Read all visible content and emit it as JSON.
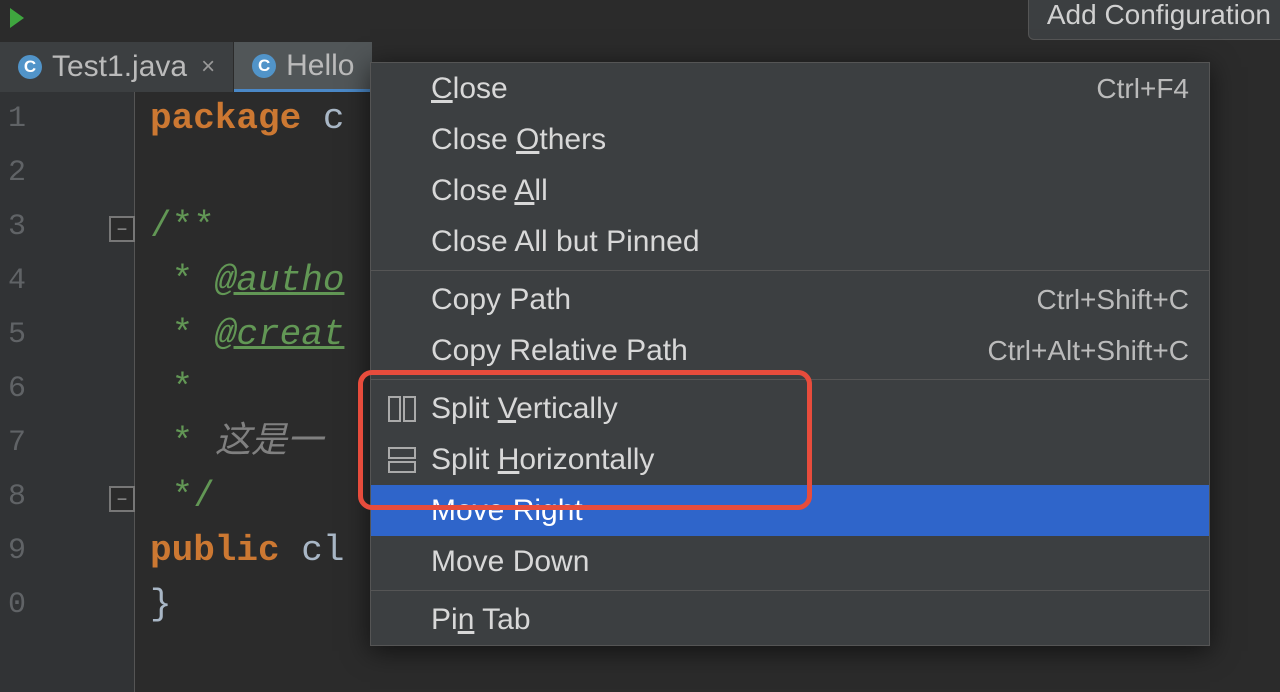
{
  "toolbar": {
    "add_config": "Add Configuration"
  },
  "tabs": [
    {
      "icon": "C",
      "label": "Test1.java"
    },
    {
      "icon": "C",
      "label": "Hello"
    }
  ],
  "gutter": {
    "lines": [
      "1",
      "2",
      "3",
      "4",
      "5",
      "6",
      "7",
      "8",
      "9",
      "0"
    ]
  },
  "code": {
    "l1_kw": "package",
    "l1_rest": " c",
    "l3": "/**",
    "l4_star": " * ",
    "l4_tag": "@autho",
    "l5_star": " * ",
    "l5_tag": "@creat",
    "l6": " *",
    "l7_star": " * ",
    "l7_txt": "这是一",
    "l8": " */",
    "l9_kw": "public",
    "l9_cl": " cl",
    "l10": "}"
  },
  "menu": {
    "close": "Close",
    "close_sc": "Ctrl+F4",
    "close_u": "C",
    "close_others_a": "Close ",
    "close_others_u": "O",
    "close_others_b": "thers",
    "close_all_a": "Close ",
    "close_all_u": "A",
    "close_all_b": "ll",
    "close_pinned": "Close All but Pinned",
    "copy_path": "Copy Path",
    "copy_path_sc": "Ctrl+Shift+C",
    "copy_rel": "Copy Relative Path",
    "copy_rel_sc": "Ctrl+Alt+Shift+C",
    "split_v_a": "Split ",
    "split_v_u": "V",
    "split_v_b": "ertically",
    "split_h_a": "Split ",
    "split_h_u": "H",
    "split_h_b": "orizontally",
    "move_right": "Move Right",
    "move_down": "Move Down",
    "pin_a": "Pi",
    "pin_u": "n",
    "pin_b": " Tab"
  }
}
